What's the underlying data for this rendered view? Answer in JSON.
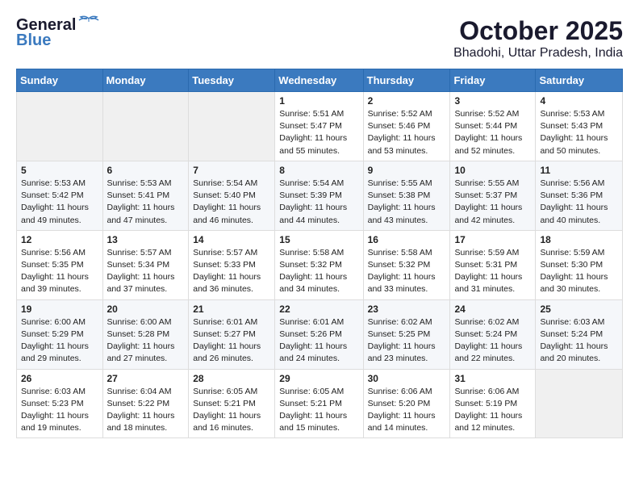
{
  "logo": {
    "line1": "General",
    "line2": "Blue"
  },
  "title": "October 2025",
  "subtitle": "Bhadohi, Uttar Pradesh, India",
  "days_of_week": [
    "Sunday",
    "Monday",
    "Tuesday",
    "Wednesday",
    "Thursday",
    "Friday",
    "Saturday"
  ],
  "weeks": [
    [
      {
        "day": "",
        "info": ""
      },
      {
        "day": "",
        "info": ""
      },
      {
        "day": "",
        "info": ""
      },
      {
        "day": "1",
        "sunrise": "5:51 AM",
        "sunset": "5:47 PM",
        "daylight": "11 hours and 55 minutes."
      },
      {
        "day": "2",
        "sunrise": "5:52 AM",
        "sunset": "5:46 PM",
        "daylight": "11 hours and 53 minutes."
      },
      {
        "day": "3",
        "sunrise": "5:52 AM",
        "sunset": "5:44 PM",
        "daylight": "11 hours and 52 minutes."
      },
      {
        "day": "4",
        "sunrise": "5:53 AM",
        "sunset": "5:43 PM",
        "daylight": "11 hours and 50 minutes."
      }
    ],
    [
      {
        "day": "5",
        "sunrise": "5:53 AM",
        "sunset": "5:42 PM",
        "daylight": "11 hours and 49 minutes."
      },
      {
        "day": "6",
        "sunrise": "5:53 AM",
        "sunset": "5:41 PM",
        "daylight": "11 hours and 47 minutes."
      },
      {
        "day": "7",
        "sunrise": "5:54 AM",
        "sunset": "5:40 PM",
        "daylight": "11 hours and 46 minutes."
      },
      {
        "day": "8",
        "sunrise": "5:54 AM",
        "sunset": "5:39 PM",
        "daylight": "11 hours and 44 minutes."
      },
      {
        "day": "9",
        "sunrise": "5:55 AM",
        "sunset": "5:38 PM",
        "daylight": "11 hours and 43 minutes."
      },
      {
        "day": "10",
        "sunrise": "5:55 AM",
        "sunset": "5:37 PM",
        "daylight": "11 hours and 42 minutes."
      },
      {
        "day": "11",
        "sunrise": "5:56 AM",
        "sunset": "5:36 PM",
        "daylight": "11 hours and 40 minutes."
      }
    ],
    [
      {
        "day": "12",
        "sunrise": "5:56 AM",
        "sunset": "5:35 PM",
        "daylight": "11 hours and 39 minutes."
      },
      {
        "day": "13",
        "sunrise": "5:57 AM",
        "sunset": "5:34 PM",
        "daylight": "11 hours and 37 minutes."
      },
      {
        "day": "14",
        "sunrise": "5:57 AM",
        "sunset": "5:33 PM",
        "daylight": "11 hours and 36 minutes."
      },
      {
        "day": "15",
        "sunrise": "5:58 AM",
        "sunset": "5:32 PM",
        "daylight": "11 hours and 34 minutes."
      },
      {
        "day": "16",
        "sunrise": "5:58 AM",
        "sunset": "5:32 PM",
        "daylight": "11 hours and 33 minutes."
      },
      {
        "day": "17",
        "sunrise": "5:59 AM",
        "sunset": "5:31 PM",
        "daylight": "11 hours and 31 minutes."
      },
      {
        "day": "18",
        "sunrise": "5:59 AM",
        "sunset": "5:30 PM",
        "daylight": "11 hours and 30 minutes."
      }
    ],
    [
      {
        "day": "19",
        "sunrise": "6:00 AM",
        "sunset": "5:29 PM",
        "daylight": "11 hours and 29 minutes."
      },
      {
        "day": "20",
        "sunrise": "6:00 AM",
        "sunset": "5:28 PM",
        "daylight": "11 hours and 27 minutes."
      },
      {
        "day": "21",
        "sunrise": "6:01 AM",
        "sunset": "5:27 PM",
        "daylight": "11 hours and 26 minutes."
      },
      {
        "day": "22",
        "sunrise": "6:01 AM",
        "sunset": "5:26 PM",
        "daylight": "11 hours and 24 minutes."
      },
      {
        "day": "23",
        "sunrise": "6:02 AM",
        "sunset": "5:25 PM",
        "daylight": "11 hours and 23 minutes."
      },
      {
        "day": "24",
        "sunrise": "6:02 AM",
        "sunset": "5:24 PM",
        "daylight": "11 hours and 22 minutes."
      },
      {
        "day": "25",
        "sunrise": "6:03 AM",
        "sunset": "5:24 PM",
        "daylight": "11 hours and 20 minutes."
      }
    ],
    [
      {
        "day": "26",
        "sunrise": "6:03 AM",
        "sunset": "5:23 PM",
        "daylight": "11 hours and 19 minutes."
      },
      {
        "day": "27",
        "sunrise": "6:04 AM",
        "sunset": "5:22 PM",
        "daylight": "11 hours and 18 minutes."
      },
      {
        "day": "28",
        "sunrise": "6:05 AM",
        "sunset": "5:21 PM",
        "daylight": "11 hours and 16 minutes."
      },
      {
        "day": "29",
        "sunrise": "6:05 AM",
        "sunset": "5:21 PM",
        "daylight": "11 hours and 15 minutes."
      },
      {
        "day": "30",
        "sunrise": "6:06 AM",
        "sunset": "5:20 PM",
        "daylight": "11 hours and 14 minutes."
      },
      {
        "day": "31",
        "sunrise": "6:06 AM",
        "sunset": "5:19 PM",
        "daylight": "11 hours and 12 minutes."
      },
      {
        "day": "",
        "info": ""
      }
    ]
  ],
  "labels": {
    "sunrise": "Sunrise: ",
    "sunset": "Sunset: ",
    "daylight": "Daylight: "
  }
}
